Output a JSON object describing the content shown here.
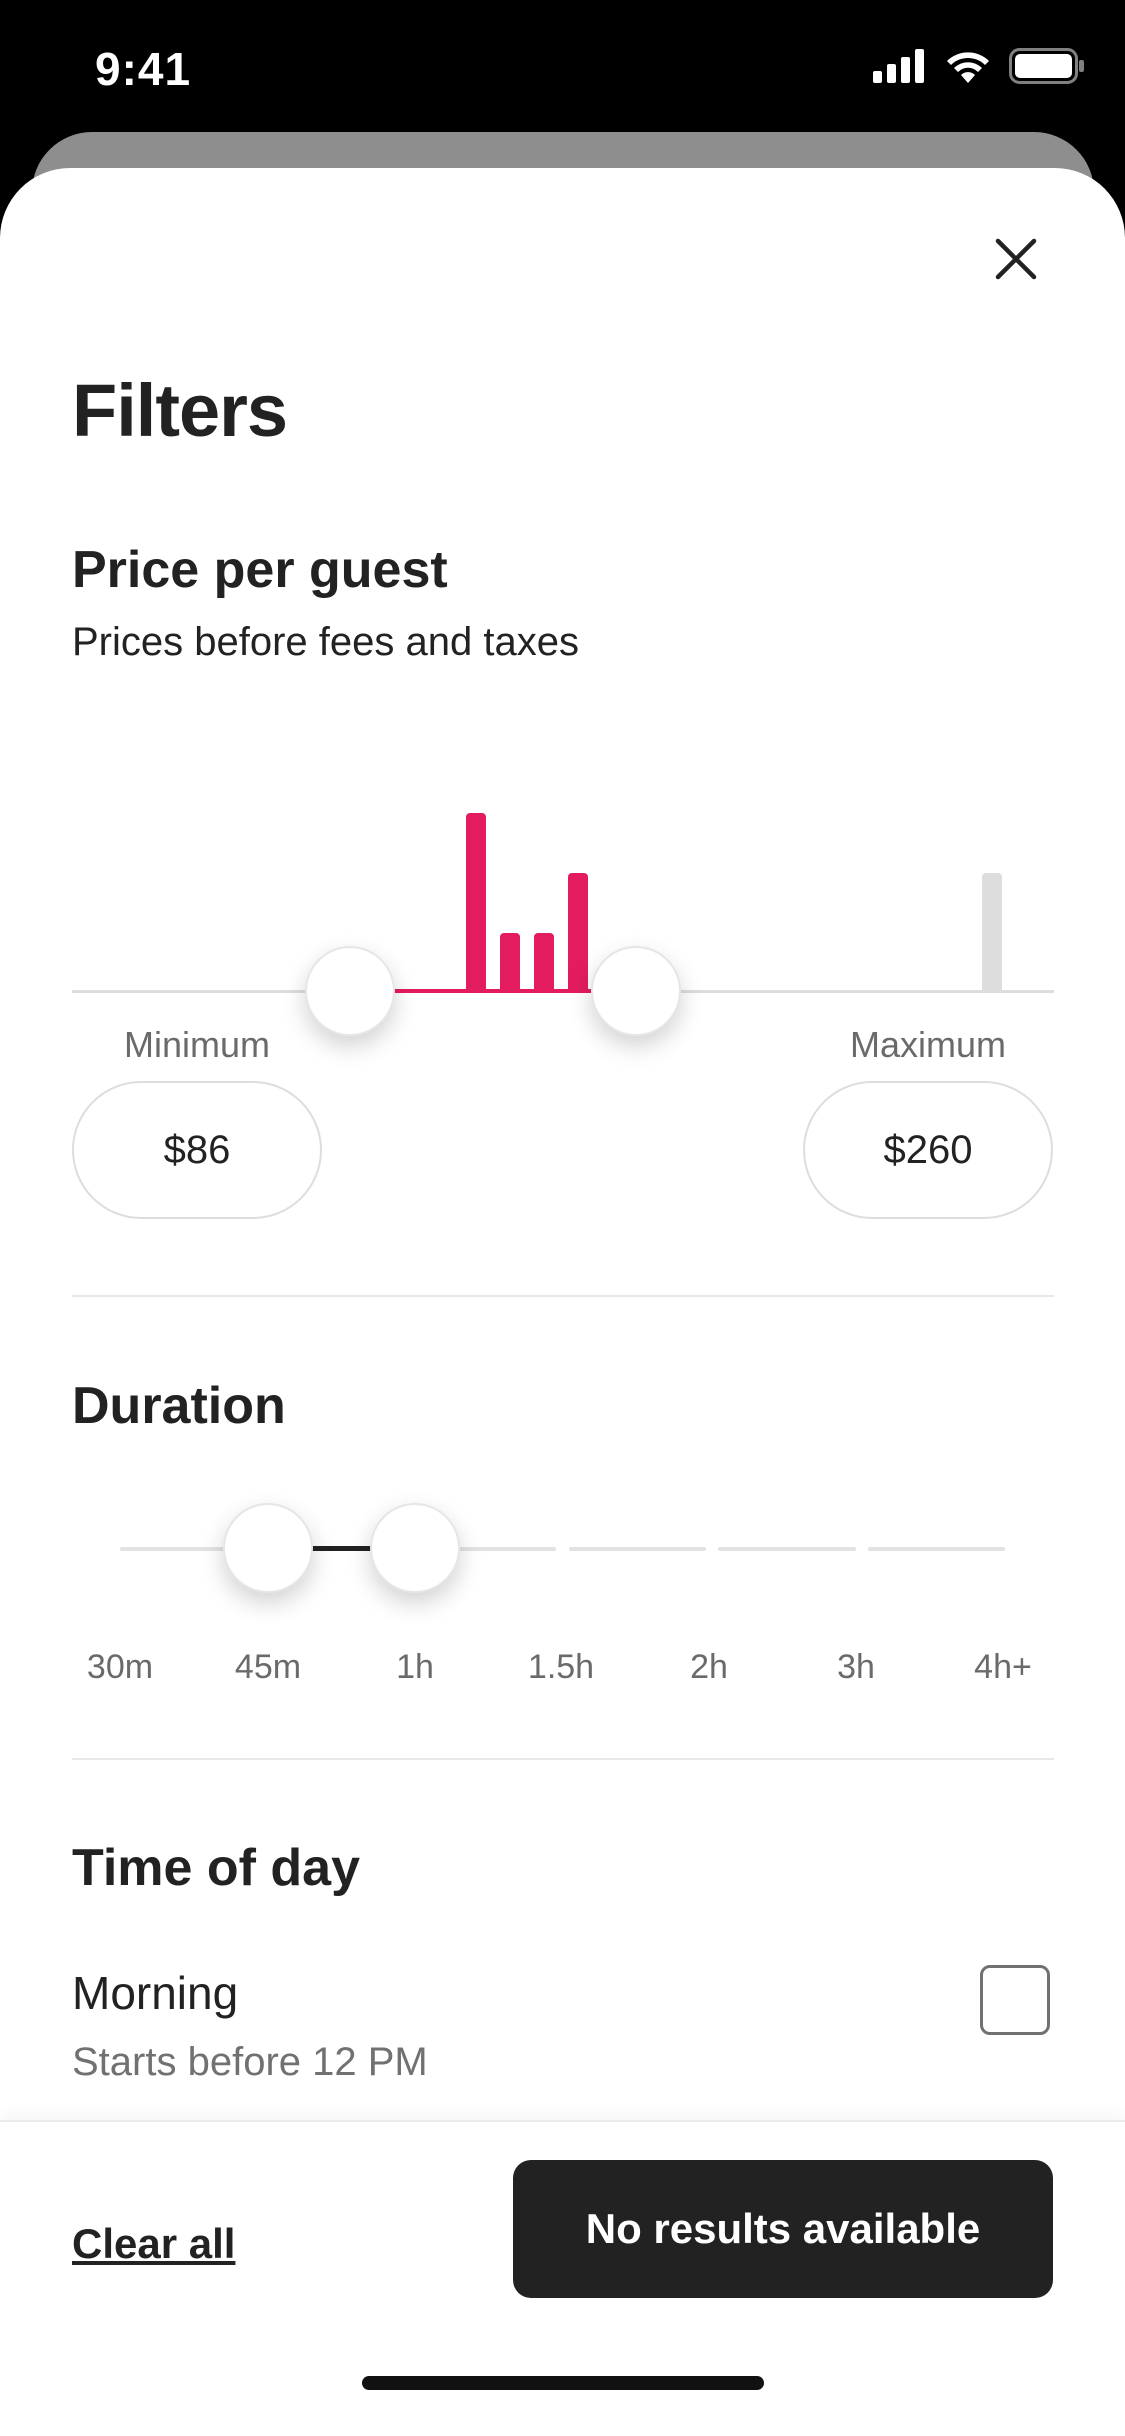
{
  "status_bar": {
    "time": "9:41"
  },
  "header": {
    "title": "Filters",
    "close_icon": "close-icon"
  },
  "price": {
    "title": "Price per guest",
    "subtitle": "Prices before fees and taxes",
    "minimum_label": "Minimum",
    "maximum_label": "Maximum",
    "minimum_value": "$86",
    "maximum_value": "$260"
  },
  "duration": {
    "title": "Duration",
    "ticks": [
      "30m",
      "45m",
      "1h",
      "1.5h",
      "2h",
      "3h",
      "4h+"
    ],
    "selected_range": [
      "45m",
      "1h"
    ]
  },
  "time_of_day": {
    "title": "Time of day",
    "options": [
      {
        "label": "Morning",
        "sub": "Starts before 12 PM",
        "checked": false
      }
    ]
  },
  "footer": {
    "clear_label": "Clear all",
    "results_label": "No results available"
  },
  "colors": {
    "accent": "#E31C5F",
    "dark": "#222222",
    "muted": "#717171"
  }
}
